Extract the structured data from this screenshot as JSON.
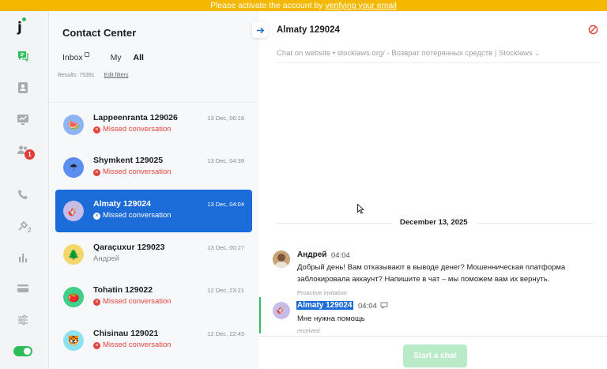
{
  "banner": {
    "text": "Please activate the account by ",
    "link": "verifying your email"
  },
  "rail": {
    "logo": "j",
    "items": [
      {
        "icon": "chat-icon",
        "active": true
      },
      {
        "icon": "contacts-icon"
      },
      {
        "icon": "analytics-icon"
      },
      {
        "icon": "team-icon",
        "badge": "1"
      },
      {
        "icon": "phone-icon"
      },
      {
        "icon": "integrations-icon",
        "sub": "2"
      },
      {
        "icon": "reports-icon"
      },
      {
        "icon": "billing-icon"
      },
      {
        "icon": "settings-icon"
      }
    ],
    "toggle": "on"
  },
  "list": {
    "title": "Contact Center",
    "tabs": [
      "Inbox",
      "My",
      "All"
    ],
    "active_tab": "All",
    "results": "Results: 75391",
    "edit_filters": "Edit filters",
    "conversations": [
      {
        "name": "Lappeenranta 129026",
        "status": "Missed conversation",
        "time": "13 Dec, 06:16",
        "avatar": "🍉",
        "avatar_bg": "#8fb4f6",
        "missed": true
      },
      {
        "name": "Shymkent 129025",
        "status": "Missed conversation",
        "time": "13 Dec, 04:39",
        "avatar": "☂",
        "avatar_bg": "#5b8ef0",
        "missed": true
      },
      {
        "name": "Almaty 129024",
        "status": "Missed conversation",
        "time": "13 Dec, 04:04",
        "avatar": "🎸",
        "avatar_bg": "#c8bde8",
        "missed": true,
        "selected": true
      },
      {
        "name": "Qaraçuxur 129023",
        "status": "Андрей",
        "time": "13 Dec, 00:27",
        "avatar": "🌲",
        "avatar_bg": "#f4d66b",
        "missed": false
      },
      {
        "name": "Tohatin 129022",
        "status": "Missed conversation",
        "time": "12 Dec, 23:21",
        "avatar": "🍅",
        "avatar_bg": "#3fcf8a",
        "missed": true
      },
      {
        "name": "Chisinau 129021",
        "status": "Missed conversation",
        "time": "12 Dec, 22:43",
        "avatar": "🐯",
        "avatar_bg": "#8ce3f0",
        "missed": true
      }
    ]
  },
  "chat": {
    "title": "Almaty 129024",
    "subtitle": "Chat on website • stocklaws.org/ - Возврат потерянных средств | Stocklaws",
    "date": "December 13, 2025",
    "messages": [
      {
        "author": "Андрей",
        "time": "04:04",
        "text_line1": "Добрый день! Вам отказывают в выводе денег? Мошенническая платформа",
        "text_line2": "заблокировала аккаунт? Напишите в чат – мы поможем вам их вернуть.",
        "note": "Proactive invitation"
      },
      {
        "author": "Almaty 129024",
        "time": "04:04",
        "text": "Мне нужна помощь",
        "note": "received"
      }
    ],
    "start_button": "Start a chat"
  },
  "colors": {
    "banner": "#f5b800",
    "accent": "#1b6bd8",
    "missed": "#e2453c",
    "green": "#2dbd5a"
  }
}
